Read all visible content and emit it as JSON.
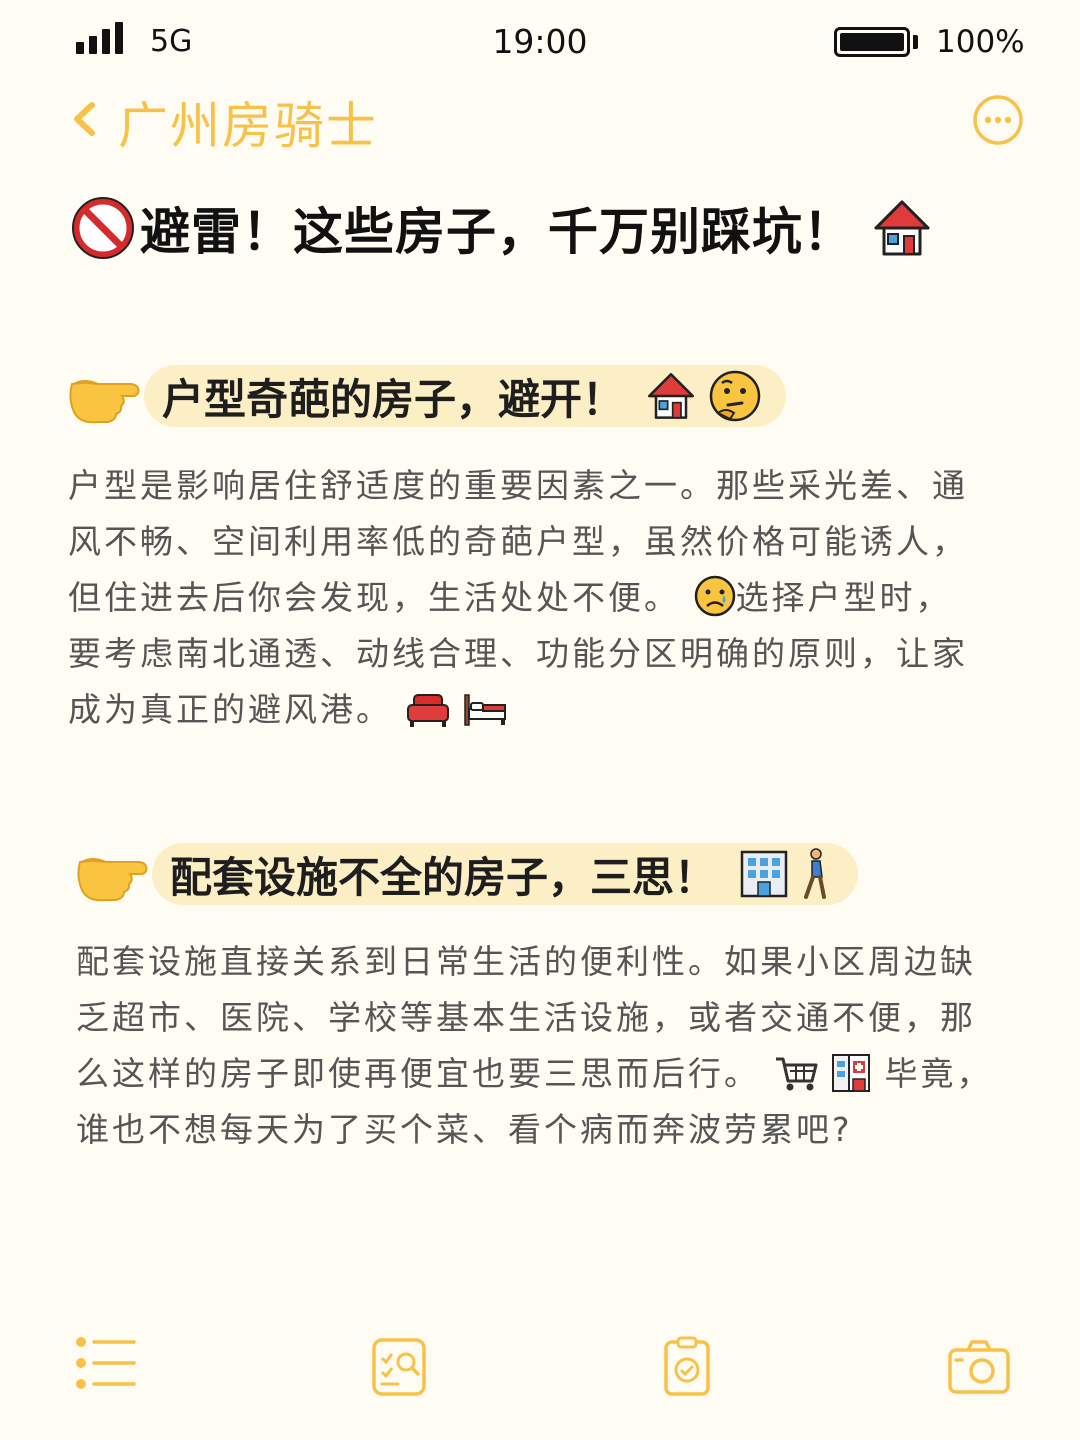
{
  "status_bar": {
    "network": "5G",
    "time": "19:00",
    "battery_percent": "100%",
    "battery_level": 1.0
  },
  "nav": {
    "title": "广州房骑士",
    "back_icon": "chevron-left-icon",
    "more_icon": "more-circle-icon"
  },
  "headline": {
    "text": "避雷！这些房子，千万别踩坑！",
    "icons": [
      "no-entry-icon",
      "house-icon"
    ]
  },
  "sections": [
    {
      "title": "户型奇葩的房子，避开！",
      "icons": [
        "pointing-hand-icon",
        "house-icon",
        "thinking-face-icon"
      ],
      "paragraph_parts": [
        "户型是影响居住舒适度的重要因素之一。那些采光差、通风不畅、空间利用率低的奇葩户型，虽然价格可能诱人，但住进去后你会发现，生活处处不便。",
        "选择户型时，要考虑南北通透、动线合理、功能分区明确的原则，让家成为真正的避风港。"
      ],
      "inline_icons": [
        "sad-face-icon",
        "sofa-icon",
        "bed-icon"
      ]
    },
    {
      "title": "配套设施不全的房子，三思！",
      "icons": [
        "pointing-hand-icon",
        "office-building-icon",
        "walking-person-icon"
      ],
      "paragraph_parts": [
        "配套设施直接关系到日常生活的便利性。如果小区周边缺乏超市、医院、学校等基本生活设施，或者交通不便，那么这样的房子即使再便宜也要三思而后行。",
        "毕竟，谁也不想每天为了买个菜、看个病而奔波劳累吧?"
      ],
      "inline_icons": [
        "shopping-cart-icon",
        "hospital-icon"
      ]
    }
  ],
  "bottom_bar": {
    "icons": [
      "list-icon",
      "search-document-icon",
      "clipboard-check-icon",
      "camera-icon"
    ]
  },
  "colors": {
    "accent": "#f8c24a",
    "pill_bg": "#fcefc6",
    "background": "#fffdf3",
    "body_text": "#555555"
  }
}
